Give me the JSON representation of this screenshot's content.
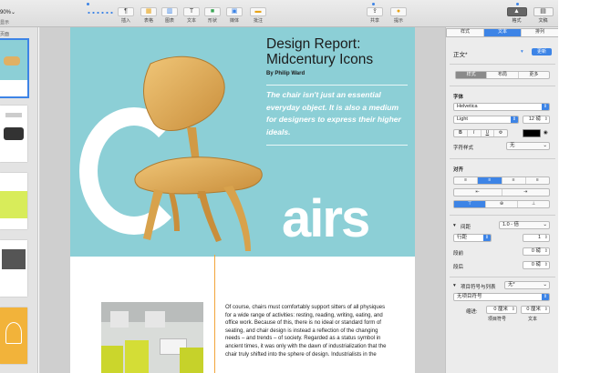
{
  "toolbar": {
    "zoom_value": "90%",
    "zoom_label": "显示",
    "tools": [
      {
        "icon": "paragraph-icon",
        "glyph": "¶",
        "label": "插入"
      },
      {
        "icon": "table-icon",
        "glyph": "▦",
        "label": "表格"
      },
      {
        "icon": "chart-icon",
        "glyph": "▥",
        "label": "图表"
      },
      {
        "icon": "text-icon",
        "glyph": "T",
        "label": "文本"
      },
      {
        "icon": "shape-icon",
        "glyph": "■",
        "label": "形状"
      },
      {
        "icon": "media-icon",
        "glyph": "▣",
        "label": "媒体"
      },
      {
        "icon": "comment-icon",
        "glyph": "▬",
        "label": "批注"
      }
    ],
    "share_label": "共享",
    "tips_label": "提示",
    "format_label": "格式",
    "document_label": "文稿"
  },
  "sidebar": {
    "header": "页面"
  },
  "document": {
    "title": "Design Report: Midcentury Icons",
    "byline": "By Philip Ward",
    "quote": "The chair isn't just an essential everyday object. It is also a medium for designers to express their higher ideals.",
    "hero_letters": "airs",
    "body": "Of course, chairs must comfortably support sitters of all physiques for a wide range of activities: resting, reading, writing, eating, and office work. Because of this, there is no ideal or standard form of seating, and chair design is instead a reflection of the changing needs – and trends – of society. Regarded as a status symbol in ancient times, it was only with the dawn of industrialization that the chair truly shifted into the sphere of design. Industrialists in the"
  },
  "inspector": {
    "tabs": [
      "样式",
      "文本",
      "排列"
    ],
    "active_tab": 1,
    "paragraph_style": "正文*",
    "update_button": "更新",
    "subtabs": [
      "样式",
      "布局",
      "更多"
    ],
    "font_heading": "字体",
    "font_family": "Helvetica",
    "font_weight": "Light",
    "font_size": "12 磅",
    "font_buttons": [
      "B",
      "I",
      "U",
      "⚙"
    ],
    "char_style_label": "字符样式",
    "char_style_value": "无",
    "align_heading": "对齐",
    "align_buttons": [
      "≡",
      "≡",
      "≡",
      "≡"
    ],
    "indent_buttons": [
      "⇤",
      "⇥"
    ],
    "valign_buttons": [
      "⊤",
      "⊕",
      "⊥"
    ],
    "spacing_label": "间距",
    "spacing_value": "1.0 - 倍",
    "line_label": "行距",
    "line_value": "1",
    "before_label": "段前",
    "before_value": "0 磅",
    "after_label": "段后",
    "after_value": "0 磅",
    "bullets_label": "项目符号与列表",
    "bullets_value": "无*",
    "bullets_style": "无项目符号",
    "indent_label": "缩进:",
    "indent_bullet_value": "0 厘米",
    "indent_text_value": "0 厘米",
    "indent_bullet_caption": "项目符号",
    "indent_text_caption": "文本"
  },
  "colors": {
    "accent": "#3d84e6",
    "hero_bg": "#8ccfd6",
    "wood": "#e0b064",
    "rule": "#f2a53a"
  }
}
